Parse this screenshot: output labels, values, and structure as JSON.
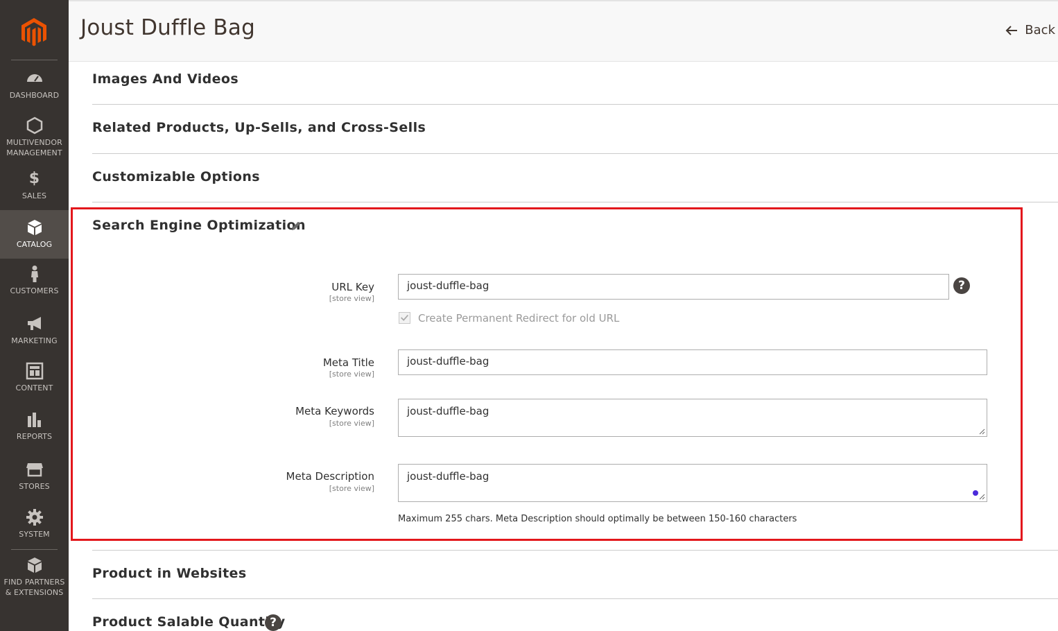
{
  "sidebar": {
    "logo": "magento-logo-icon",
    "items": [
      {
        "label": "DASHBOARD",
        "icon": "speedometer-icon"
      },
      {
        "label": "MULTIVENDOR MANAGEMENT",
        "icon": "hexagon-icon"
      },
      {
        "label": "SALES",
        "icon": "dollar-icon"
      },
      {
        "label": "CATALOG",
        "icon": "box-icon",
        "active": true
      },
      {
        "label": "CUSTOMERS",
        "icon": "person-icon"
      },
      {
        "label": "MARKETING",
        "icon": "megaphone-icon"
      },
      {
        "label": "CONTENT",
        "icon": "layout-icon"
      },
      {
        "label": "REPORTS",
        "icon": "bar-chart-icon"
      },
      {
        "label": "STORES",
        "icon": "storefront-icon"
      },
      {
        "label": "SYSTEM",
        "icon": "gear-icon"
      },
      {
        "label": "FIND PARTNERS & EXTENSIONS",
        "icon": "blocks-icon"
      }
    ]
  },
  "header": {
    "title": "Joust Duffle Bag",
    "back_label": "Back"
  },
  "sections": {
    "images": "Images And Videos",
    "related": "Related Products, Up-Sells, and Cross-Sells",
    "custom_options": "Customizable Options",
    "seo": "Search Engine Optimization",
    "websites": "Product in Websites",
    "salable": "Product Salable Quantity"
  },
  "seo": {
    "url_key": {
      "label": "URL Key",
      "scope": "[store view]",
      "value": "joust-duffle-bag"
    },
    "redirect": {
      "label": "Create Permanent Redirect for old URL",
      "checked": true
    },
    "meta_title": {
      "label": "Meta Title",
      "scope": "[store view]",
      "value": "joust-duffle-bag"
    },
    "meta_keywords": {
      "label": "Meta Keywords",
      "scope": "[store view]",
      "value": "joust-duffle-bag"
    },
    "meta_description": {
      "label": "Meta Description",
      "scope": "[store view]",
      "value": "joust-duffle-bag"
    },
    "note": "Maximum 255 chars. Meta Description should optimally be between 150-160 characters"
  },
  "colors": {
    "sidebar_bg": "#373330",
    "active_bg": "#524d49",
    "highlight": "#e3171c",
    "logo": "#eb5202"
  }
}
